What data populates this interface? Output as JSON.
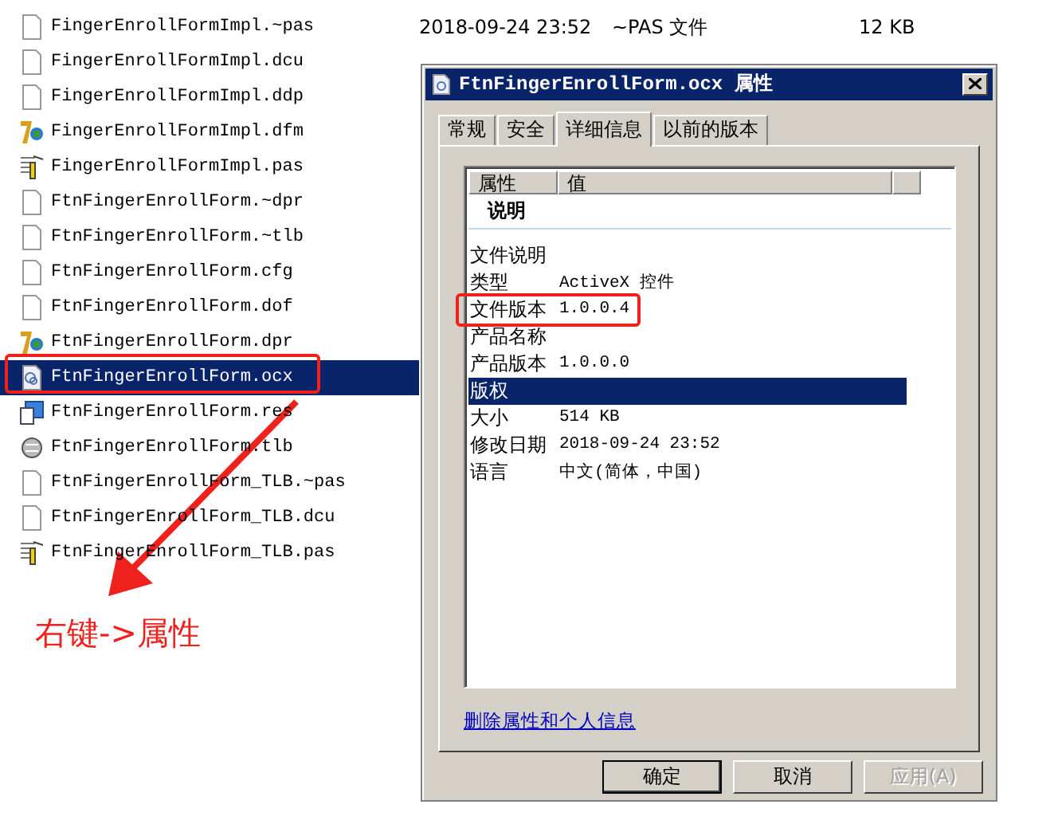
{
  "files": [
    {
      "name": "FingerEnrollFormImpl.~pas",
      "kind": "blank",
      "selected": false,
      "date": "2018-09-24 23:52",
      "type": "~PAS 文件",
      "size": "12 KB"
    },
    {
      "name": "FingerEnrollFormImpl.dcu",
      "kind": "blank",
      "selected": false
    },
    {
      "name": "FingerEnrollFormImpl.ddp",
      "kind": "blank",
      "selected": false
    },
    {
      "name": "FingerEnrollFormImpl.dfm",
      "kind": "delphi",
      "selected": false
    },
    {
      "name": "FingerEnrollFormImpl.pas",
      "kind": "pas",
      "selected": false
    },
    {
      "name": "FtnFingerEnrollForm.~dpr",
      "kind": "blank",
      "selected": false
    },
    {
      "name": "FtnFingerEnrollForm.~tlb",
      "kind": "blank",
      "selected": false
    },
    {
      "name": "FtnFingerEnrollForm.cfg",
      "kind": "blank",
      "selected": false
    },
    {
      "name": "FtnFingerEnrollForm.dof",
      "kind": "blank",
      "selected": false
    },
    {
      "name": "FtnFingerEnrollForm.dpr",
      "kind": "delphi",
      "selected": false
    },
    {
      "name": "FtnFingerEnrollForm.ocx",
      "kind": "ocx",
      "selected": true
    },
    {
      "name": "FtnFingerEnrollForm.res",
      "kind": "res",
      "selected": false
    },
    {
      "name": "FtnFingerEnrollForm.tlb",
      "kind": "tlb",
      "selected": false
    },
    {
      "name": "FtnFingerEnrollForm_TLB.~pas",
      "kind": "blank",
      "selected": false
    },
    {
      "name": "FtnFingerEnrollForm_TLB.dcu",
      "kind": "blank",
      "selected": false
    },
    {
      "name": "FtnFingerEnrollForm_TLB.pas",
      "kind": "pas",
      "selected": false
    }
  ],
  "dialog": {
    "title": "FtnFingerEnrollForm.ocx 属性",
    "tabs": [
      {
        "label": "常规",
        "selected": false
      },
      {
        "label": "安全",
        "selected": false
      },
      {
        "label": "详细信息",
        "selected": true
      },
      {
        "label": "以前的版本",
        "selected": false
      }
    ],
    "columns": [
      "属性",
      "值"
    ],
    "group": "说明",
    "properties": [
      {
        "name": "文件说明",
        "selected": false
      },
      {
        "name": "类型",
        "value": "ActiveX 控件",
        "selected": false
      },
      {
        "name": "文件版本",
        "value": "1.0.0.4",
        "selected": false
      },
      {
        "name": "产品名称",
        "selected": false
      },
      {
        "name": "产品版本",
        "value": "1.0.0.0",
        "selected": false
      },
      {
        "name": "版权",
        "selected": true
      },
      {
        "name": "大小",
        "value": "514 KB",
        "selected": false
      },
      {
        "name": "修改日期",
        "value": "2018-09-24 23:52",
        "selected": false
      },
      {
        "name": "语言",
        "value": "中文(简体，中国)",
        "selected": false
      }
    ],
    "link": "删除属性和个人信息",
    "buttons": [
      {
        "label": "确定",
        "default": true,
        "disabled": false
      },
      {
        "label": "取消",
        "default": false,
        "disabled": false
      },
      {
        "label": "应用(A)",
        "default": false,
        "disabled": true
      }
    ]
  },
  "annotation": "右键->属性"
}
